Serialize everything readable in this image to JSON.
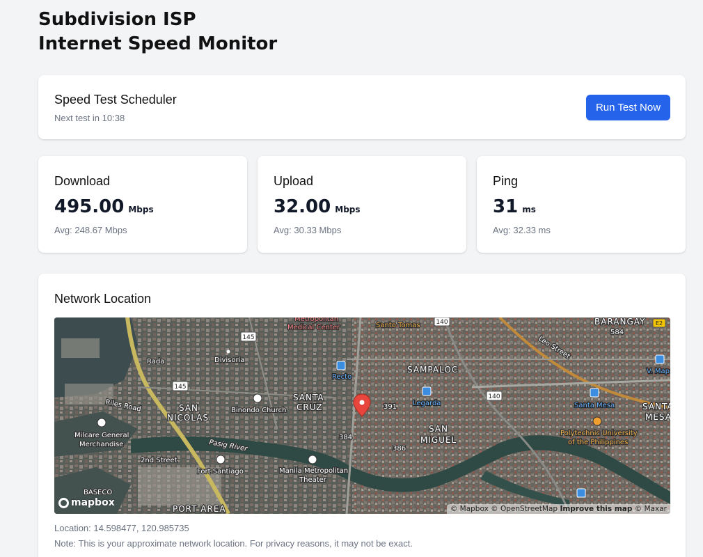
{
  "app": {
    "title_line1": "Subdivision ISP",
    "title_line2": "Internet Speed Monitor"
  },
  "scheduler": {
    "title": "Speed Test Scheduler",
    "next_test": "Next test in 10:38",
    "run_button": "Run Test Now"
  },
  "metrics": [
    {
      "label": "Download",
      "value": "495.00",
      "unit": "Mbps",
      "avg": "Avg: 248.67 Mbps"
    },
    {
      "label": "Upload",
      "value": "32.00",
      "unit": "Mbps",
      "avg": "Avg: 30.33 Mbps"
    },
    {
      "label": "Ping",
      "value": "31",
      "unit": "ms",
      "avg": "Avg: 32.33 ms"
    }
  ],
  "location": {
    "title": "Network Location",
    "coords": "Location: 14.598477, 120.985735",
    "note": "Note: This is your approximate network location. For privacy reasons, it may not be exact."
  },
  "map": {
    "logo": "mapbox",
    "attribution_1": "© Mapbox",
    "attribution_2": "© OpenStreetMap",
    "attribution_improve": "Improve this map",
    "attribution_3": "© Maxar",
    "labels": {
      "barangay": "BARANGAY",
      "n584": "584",
      "santo_tomas": "Santo Tomas",
      "metropolitan": "Metropolitan",
      "medical_center": "Medical Center",
      "r140a": "140",
      "r145a": "145",
      "r145b": "145",
      "r140b": "140",
      "e2": "E2",
      "rada": "Rada",
      "divisoria": "Divisoria",
      "recto": "Recto",
      "sampaloc": "SAMPALOC",
      "leo_street": "Leo Street",
      "v_mapa": "V. Mapa",
      "santa": "SANTA",
      "cruz": "CRUZ",
      "san1": "SAN",
      "nicolas": "NICOLAS",
      "binondo_church": "Binondo Church",
      "n391": "391",
      "legarda": "Legarda",
      "santa_mesa": "Santa Mesa",
      "santa2": "SANTA",
      "mesa": "MESA",
      "riles_road": "Riles Road",
      "milcare1": "Milcare General",
      "milcare2": "Merchandise",
      "pasig_river": "Pasig River",
      "n384": "384",
      "san2": "SAN",
      "miguel": "MIGUEL",
      "pup1": "Polytechnic University",
      "pup2": "of the Philippines",
      "n386": "386",
      "second_street": "2nd Street",
      "fort_santiago": "Fort Santiago",
      "manila_metro": "Manila Metropolitan",
      "theater": "Theater",
      "baseco": "BASECO",
      "port_area": "PORT AREA"
    }
  },
  "colors": {
    "accent": "#2563eb",
    "background": "#f3f4f6",
    "muted_text": "#6b7280"
  }
}
